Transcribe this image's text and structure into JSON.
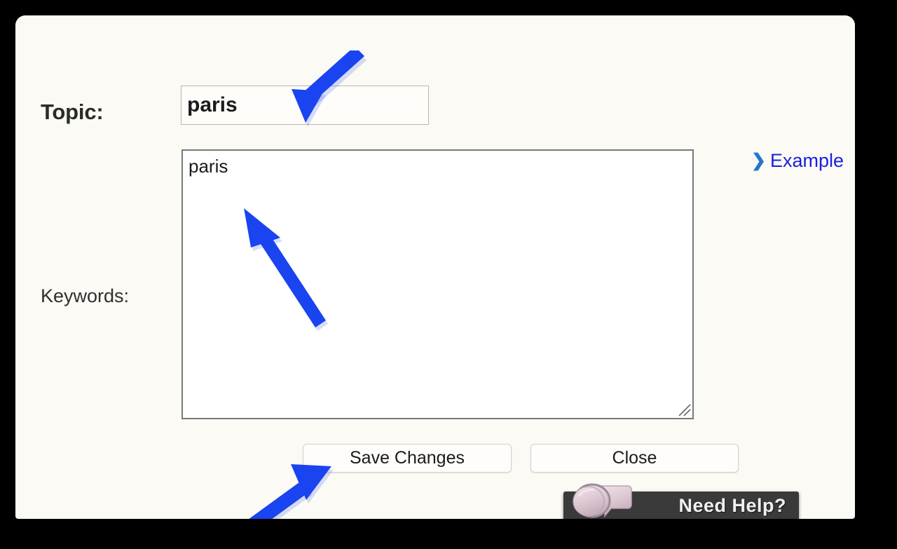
{
  "page": {
    "background_color": "#fcfaf5",
    "frame_color": "#000000"
  },
  "form": {
    "topic": {
      "label": "Topic:",
      "value": "paris",
      "placeholder": ""
    },
    "keywords": {
      "label": "Keywords:",
      "value": "paris",
      "placeholder": ""
    }
  },
  "example_link": {
    "chevron_icon": "chevron-right-icon",
    "chevron_glyph": "❯",
    "label": "Example",
    "text_color": "#1920e0",
    "chevron_color": "#2277cc"
  },
  "buttons": {
    "save_label": "Save Changes",
    "close_label": "Close"
  },
  "help_widget": {
    "label": "Need Help?",
    "icon": "chat-bubbles-icon",
    "background_color": "#3a3a3a",
    "text_color": "#f2eff0"
  },
  "annotations": {
    "arrow_color": "#1a44ef",
    "arrows": [
      {
        "name": "arrow-to-topic-input",
        "points_to": "topic-input",
        "direction": "down-left"
      },
      {
        "name": "arrow-to-keywords-textarea",
        "points_to": "keywords-textarea",
        "direction": "up-left"
      },
      {
        "name": "arrow-to-save-button",
        "points_to": "save-changes-button",
        "direction": "up-right"
      }
    ]
  }
}
